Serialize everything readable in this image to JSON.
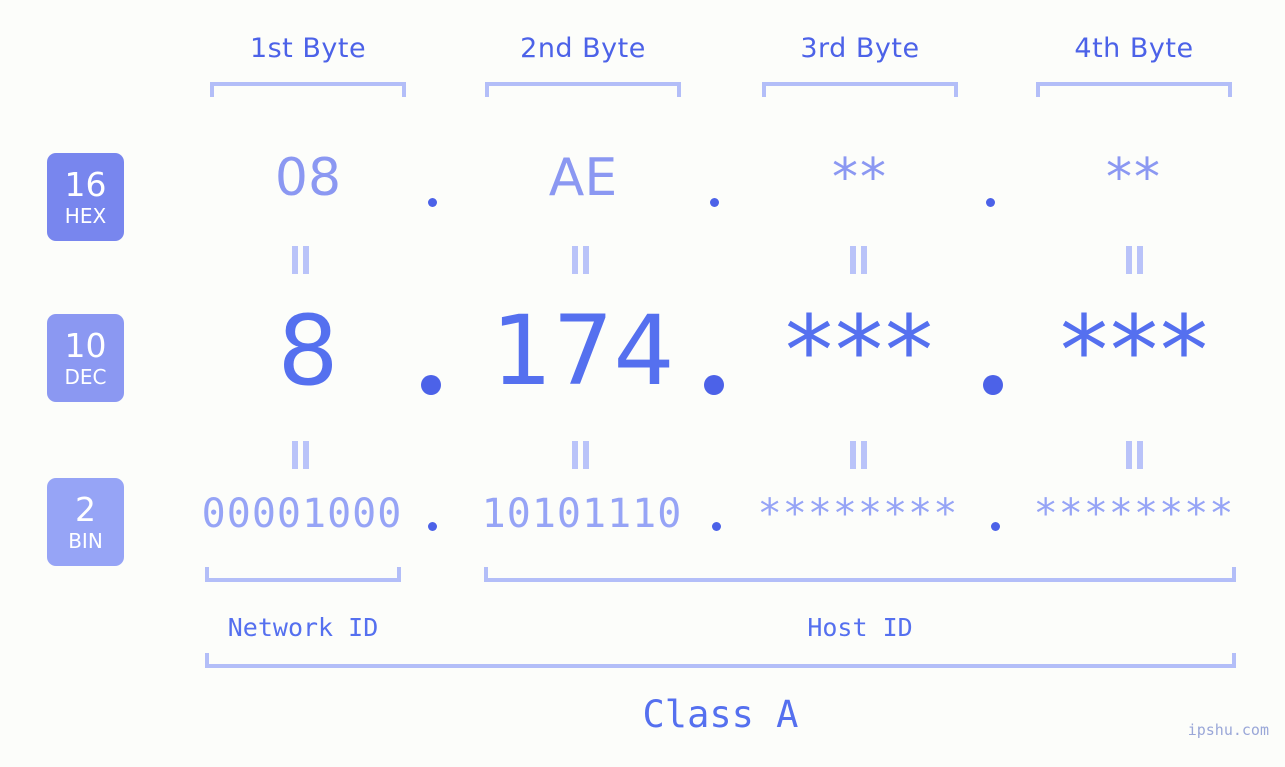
{
  "background_color": "#fcfdfa",
  "accent_colors": {
    "header_text": "#4c62e8",
    "bracket": "#b3bef8",
    "hex_value": "#8b98f2",
    "dec_value": "#5570ef",
    "bin_value": "#96a4f6",
    "badge_hex": "#7886ee",
    "badge_dec": "#8b98f2",
    "badge_bin": "#96a4f6",
    "dot": "#4c62e8",
    "connector": "#b9c3f9",
    "watermark": "#9aa7d8"
  },
  "byte_headers": [
    {
      "label": "1st Byte"
    },
    {
      "label": "2nd Byte"
    },
    {
      "label": "3rd Byte"
    },
    {
      "label": "4th Byte"
    }
  ],
  "rows": [
    {
      "badge": {
        "base": "16",
        "system": "HEX"
      },
      "values": [
        "08",
        "AE",
        "**",
        "**"
      ]
    },
    {
      "badge": {
        "base": "10",
        "system": "DEC"
      },
      "values": [
        "8",
        "174",
        "***",
        "***"
      ]
    },
    {
      "badge": {
        "base": "2",
        "system": "BIN"
      },
      "values": [
        "00001000",
        "10101110",
        "********",
        "********"
      ]
    }
  ],
  "separators": {
    "dot": ".",
    "equals": "="
  },
  "segments": {
    "network_id": "Network ID",
    "host_id": "Host ID",
    "class": "Class A"
  },
  "watermark": "ipshu.com"
}
